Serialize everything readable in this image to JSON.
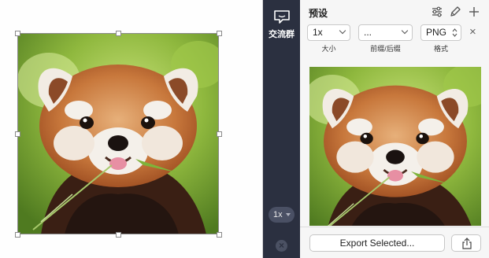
{
  "sidebar": {
    "chat_label": "交流群",
    "zoom_value": "1x"
  },
  "panel": {
    "title": "预设",
    "size_value": "1x",
    "size_caption": "大小",
    "prefix_value": "...",
    "prefix_caption": "前缀/后缀",
    "format_value": "PNG",
    "format_caption": "格式",
    "remove_symbol": "×",
    "export_label": "Export Selected..."
  },
  "icons": {
    "settings": "sliders-icon",
    "edit": "pencil-icon",
    "add": "plus-icon",
    "share": "share-icon",
    "chat": "chat-bubble-icon",
    "close": "close-circle-icon"
  },
  "colors": {
    "rail_background": "#2b3040",
    "panel_background": "#f6f6f6"
  }
}
